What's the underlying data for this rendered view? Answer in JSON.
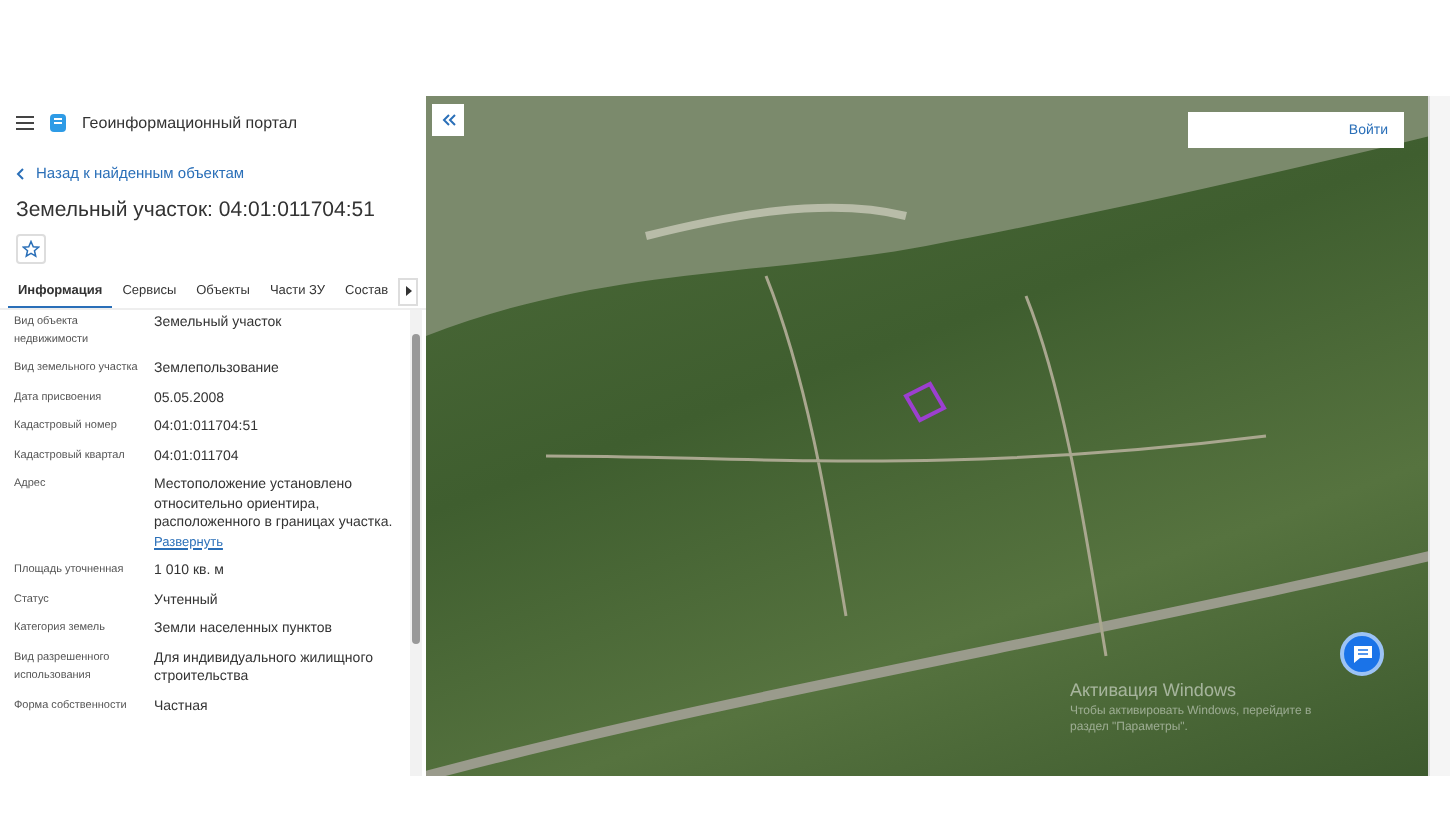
{
  "header": {
    "title": "Геоинформационный портал"
  },
  "back_link": "Назад к найденным объектам",
  "object_title": "Земельный участок: 04:01:011704:51",
  "favorite": {
    "selected": false
  },
  "tabs": [
    {
      "label": "Информация",
      "selected": true
    },
    {
      "label": "Сервисы",
      "selected": false
    },
    {
      "label": "Объекты",
      "selected": false
    },
    {
      "label": "Части ЗУ",
      "selected": false
    },
    {
      "label": "Состав",
      "selected": false
    }
  ],
  "fields": [
    {
      "label": "Вид объекта недвижимости",
      "value": "Земельный участок"
    },
    {
      "label": "Вид земельного участка",
      "value": "Землепользование"
    },
    {
      "label": "Дата присвоения",
      "value": "05.05.2008"
    },
    {
      "label": "Кадастровый номер",
      "value": "04:01:011704:51"
    },
    {
      "label": "Кадастровый квартал",
      "value": "04:01:011704"
    },
    {
      "label": "Адрес",
      "value": "Местоположение установлено относительно ориентира, расположенного в границах участка.",
      "expand": "Развернуть"
    },
    {
      "label": "Площадь уточненная",
      "value": "1 010 кв. м"
    },
    {
      "label": "Статус",
      "value": "Учтенный"
    },
    {
      "label": "Категория земель",
      "value": "Земли населенных пунктов"
    },
    {
      "label": "Вид разрешенного использования",
      "value": "Для индивидуального жилищного строительства"
    },
    {
      "label": "Форма собственности",
      "value": "Частная"
    }
  ],
  "map": {
    "login": "Войти",
    "activation_title": "Активация Windows",
    "activation_text": "Чтобы активировать Windows, перейдите в раздел \"Параметры\"."
  }
}
